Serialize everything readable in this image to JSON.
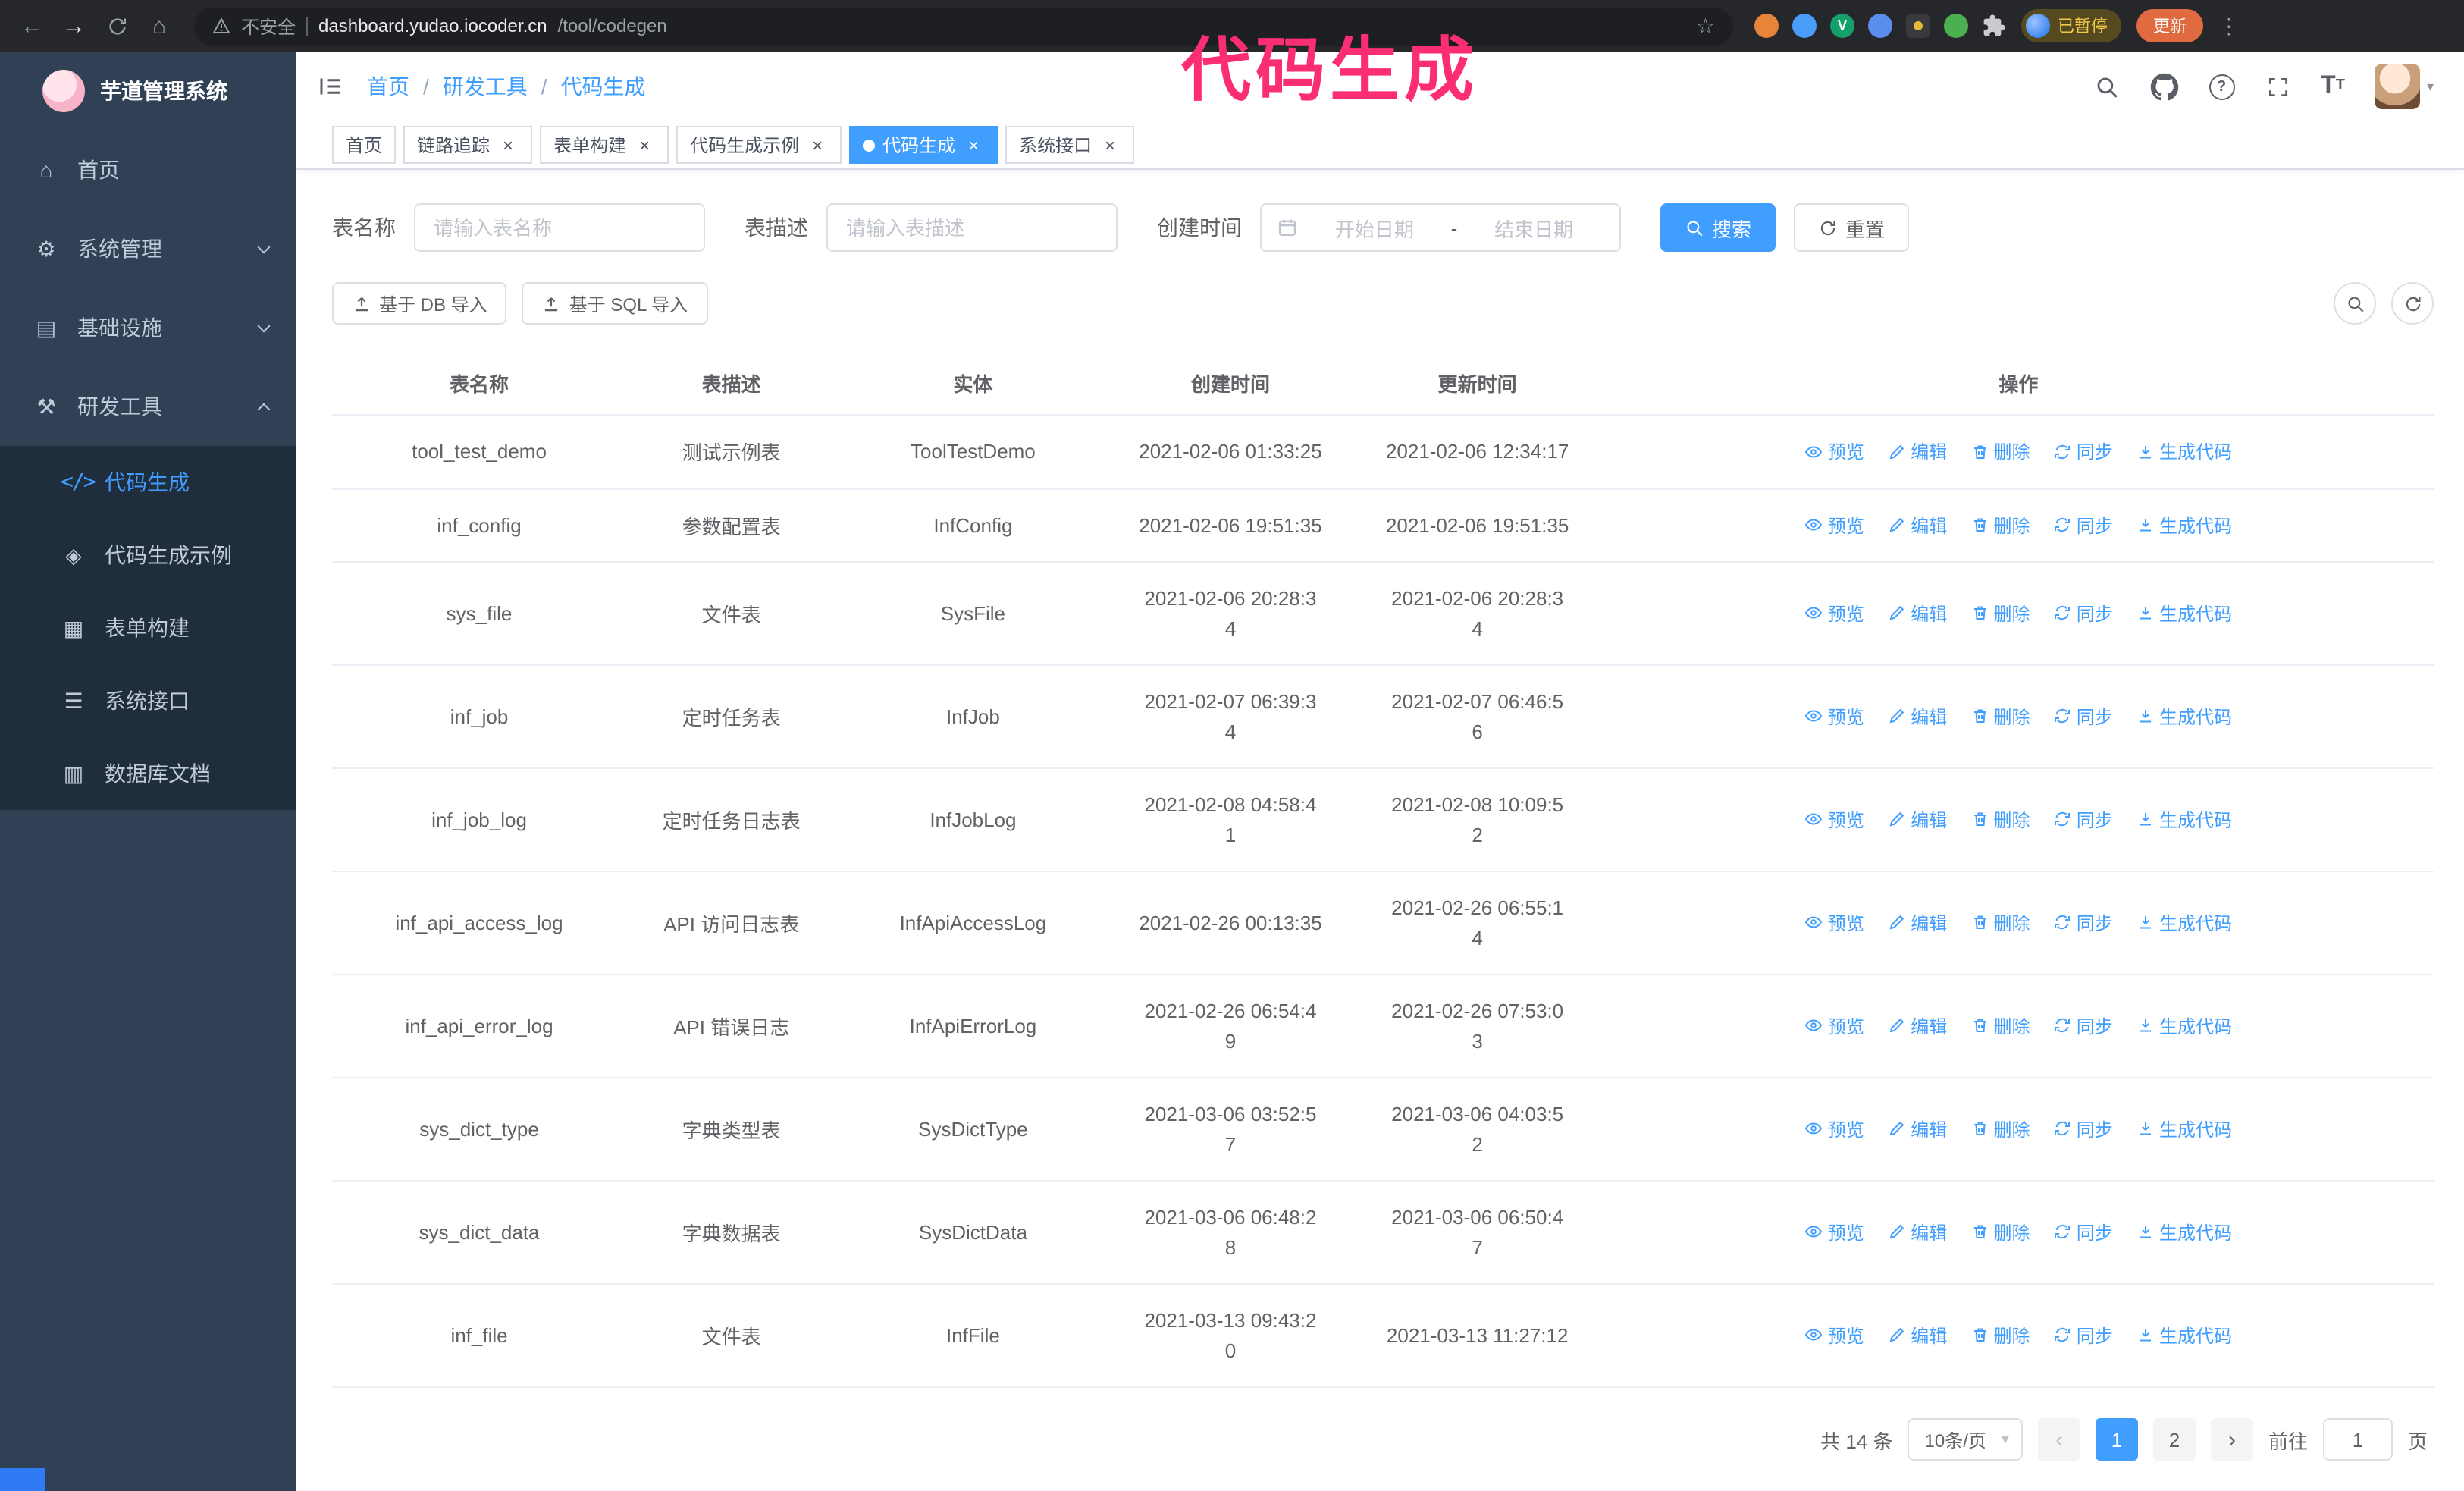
{
  "colors": {
    "primary": "#409EFF",
    "annotation_pink": "#FB2E74",
    "sidebar_bg": "#304156",
    "submenu_bg": "#1F2D3D"
  },
  "browser": {
    "security_label": "不安全",
    "url_domain": "dashboard.yudao.iocoder.cn",
    "url_path": "/tool/codegen",
    "paused_badge": "已暂停",
    "update_button": "更新"
  },
  "annotation": "代码生成",
  "sidebar": {
    "logo_title": "芋道管理系统",
    "items": [
      {
        "label": "首页"
      },
      {
        "label": "系统管理"
      },
      {
        "label": "基础设施"
      },
      {
        "label": "研发工具"
      }
    ],
    "submenu": [
      {
        "label": "代码生成",
        "active": true
      },
      {
        "label": "代码生成示例"
      },
      {
        "label": "表单构建"
      },
      {
        "label": "系统接口"
      },
      {
        "label": "数据库文档"
      }
    ]
  },
  "navbar": {
    "breadcrumb": [
      "首页",
      "研发工具",
      "代码生成"
    ]
  },
  "tabs": [
    {
      "label": "首页",
      "closable": false
    },
    {
      "label": "链路追踪",
      "closable": true
    },
    {
      "label": "表单构建",
      "closable": true
    },
    {
      "label": "代码生成示例",
      "closable": true
    },
    {
      "label": "代码生成",
      "closable": true,
      "active": true
    },
    {
      "label": "系统接口",
      "closable": true
    }
  ],
  "filters": {
    "name_label": "表名称",
    "name_placeholder": "请输入表名称",
    "desc_label": "表描述",
    "desc_placeholder": "请输入表描述",
    "time_label": "创建时间",
    "start_placeholder": "开始日期",
    "range_separator": "-",
    "end_placeholder": "结束日期",
    "search_button": "搜索",
    "reset_button": "重置"
  },
  "toolbar": {
    "import_db": "基于 DB 导入",
    "import_sql": "基于 SQL 导入"
  },
  "table": {
    "headers": [
      "表名称",
      "表描述",
      "实体",
      "创建时间",
      "更新时间",
      "操作"
    ],
    "ops": [
      "预览",
      "编辑",
      "删除",
      "同步",
      "生成代码"
    ],
    "rows": [
      {
        "name": "tool_test_demo",
        "desc": "测试示例表",
        "entity": "ToolTestDemo",
        "created": "2021-02-06 01:33:25",
        "updated": "2021-02-06 12:34:17"
      },
      {
        "name": "inf_config",
        "desc": "参数配置表",
        "entity": "InfConfig",
        "created": "2021-02-06 19:51:35",
        "updated": "2021-02-06 19:51:35"
      },
      {
        "name": "sys_file",
        "desc": "文件表",
        "entity": "SysFile",
        "created": "2021-02-06 20:28:3\n4",
        "updated": "2021-02-06 20:28:3\n4"
      },
      {
        "name": "inf_job",
        "desc": "定时任务表",
        "entity": "InfJob",
        "created": "2021-02-07 06:39:3\n4",
        "updated": "2021-02-07 06:46:5\n6"
      },
      {
        "name": "inf_job_log",
        "desc": "定时任务日志表",
        "entity": "InfJobLog",
        "created": "2021-02-08 04:58:4\n1",
        "updated": "2021-02-08 10:09:5\n2"
      },
      {
        "name": "inf_api_access_log",
        "desc": "API 访问日志表",
        "entity": "InfApiAccessLog",
        "created": "2021-02-26 00:13:35",
        "updated": "2021-02-26 06:55:1\n4"
      },
      {
        "name": "inf_api_error_log",
        "desc": "API 错误日志",
        "entity": "InfApiErrorLog",
        "created": "2021-02-26 06:54:4\n9",
        "updated": "2021-02-26 07:53:0\n3"
      },
      {
        "name": "sys_dict_type",
        "desc": "字典类型表",
        "entity": "SysDictType",
        "created": "2021-03-06 03:52:5\n7",
        "updated": "2021-03-06 04:03:5\n2"
      },
      {
        "name": "sys_dict_data",
        "desc": "字典数据表",
        "entity": "SysDictData",
        "created": "2021-03-06 06:48:2\n8",
        "updated": "2021-03-06 06:50:4\n7"
      },
      {
        "name": "inf_file",
        "desc": "文件表",
        "entity": "InfFile",
        "created": "2021-03-13 09:43:2\n0",
        "updated": "2021-03-13 11:27:12"
      }
    ]
  },
  "pagination": {
    "total": "共 14 条",
    "page_size": "10条/页",
    "pages": [
      "1",
      "2"
    ],
    "active_page": "1",
    "jump_prefix": "前往",
    "jump_value": "1",
    "jump_suffix": "页"
  }
}
